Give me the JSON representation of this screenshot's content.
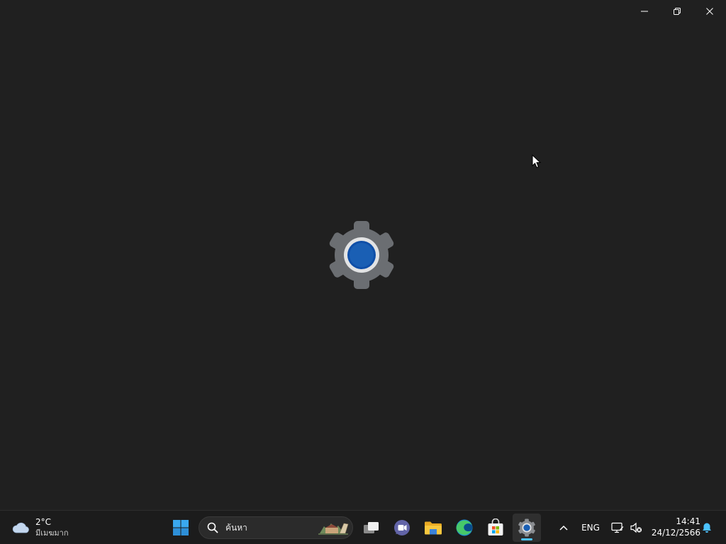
{
  "window": {
    "caption_buttons": [
      "minimize",
      "restore",
      "close"
    ],
    "splash_icon": "settings-gear-icon"
  },
  "taskbar": {
    "weather": {
      "temperature": "2°C",
      "condition": "มีเมฆมาก",
      "icon": "cloudy-icon"
    },
    "search": {
      "placeholder": "ค้นหา"
    },
    "pinned_apps": [
      {
        "name": "Start",
        "icon": "windows-start-icon"
      },
      {
        "name": "Task View",
        "icon": "task-view-icon"
      },
      {
        "name": "Chat",
        "icon": "chat-icon"
      },
      {
        "name": "File Explorer",
        "icon": "file-explorer-icon"
      },
      {
        "name": "Microsoft Edge",
        "icon": "edge-icon"
      },
      {
        "name": "Microsoft Store",
        "icon": "store-icon"
      },
      {
        "name": "Settings",
        "icon": "settings-icon",
        "active": true
      }
    ],
    "tray": {
      "language": "ENG",
      "time": "14:41",
      "date": "24/12/2566"
    }
  },
  "colors": {
    "background": "#202020",
    "taskbar": "#1c1c1c",
    "accent": "#4cc2ff",
    "gear": "#6b6e72",
    "gear_center": "#1a5fb4"
  }
}
